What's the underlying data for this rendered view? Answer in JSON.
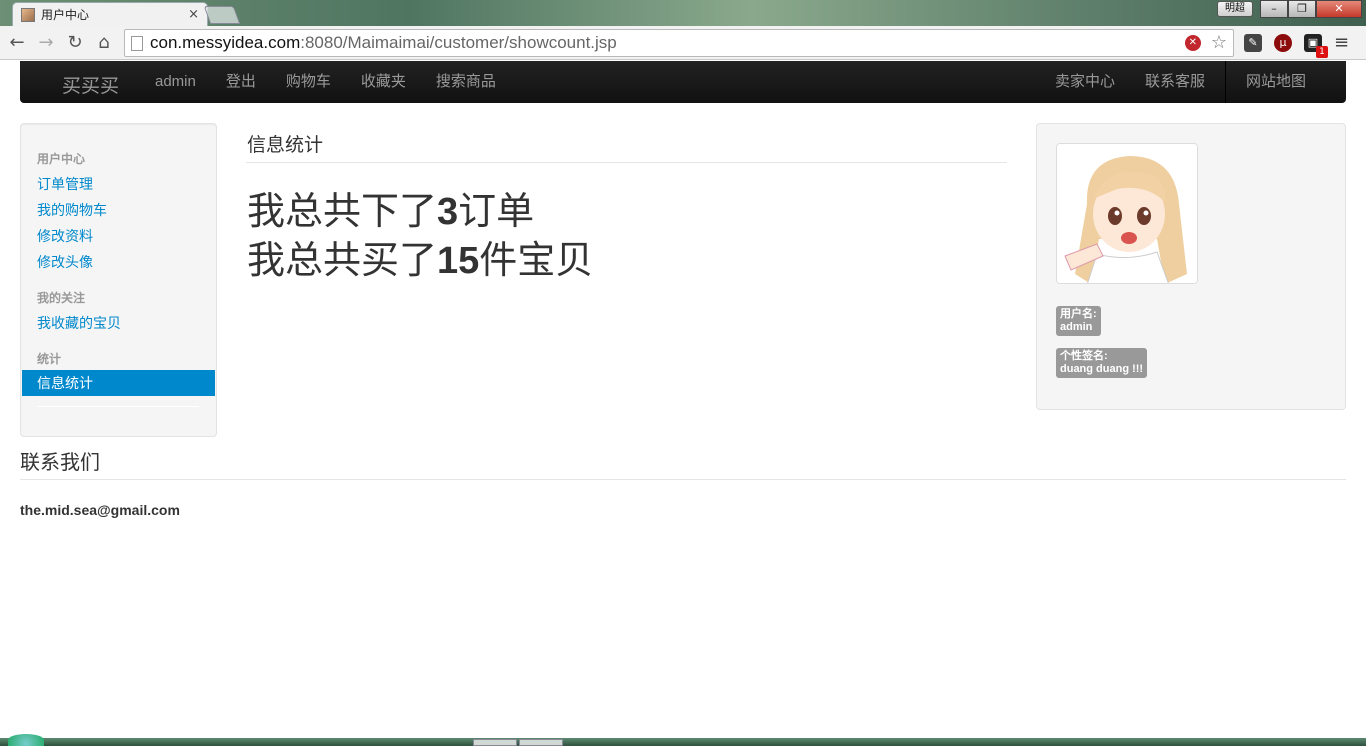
{
  "browser": {
    "tab_title": "用户中心",
    "tab_close": "×",
    "window_user": "明超",
    "window_buttons": [
      "–",
      "❐",
      "✕"
    ],
    "url_host": "con.messyidea.com",
    "url_rest": ":8080/Maimaimai/customer/showcount.jsp",
    "nav_glyphs": {
      "back": "←",
      "forward": "→",
      "reload": "↻",
      "home": "⌂"
    },
    "star": "☆",
    "menu": "≡",
    "ext_badge": "1"
  },
  "navbar": {
    "brand": "买买买",
    "left_items": [
      "admin",
      "登出",
      "购物车",
      "收藏夹",
      "搜索商品"
    ],
    "right_items": [
      "卖家中心",
      "联系客服",
      "网站地图"
    ]
  },
  "sidebar": {
    "sections": [
      {
        "header": "用户中心",
        "links": [
          "订单管理",
          "我的购物车",
          "修改资料",
          "修改头像"
        ]
      },
      {
        "header": "我的关注",
        "links": [
          "我收藏的宝贝"
        ]
      },
      {
        "header": "统计",
        "links": []
      }
    ],
    "active": "信息统计"
  },
  "main": {
    "title": "信息统计",
    "line1_prefix": "我总共下了",
    "line1_count": "3",
    "line1_suffix": "订单",
    "line2_prefix": "我总共买了",
    "line2_count": "15",
    "line2_suffix": "件宝贝"
  },
  "profile": {
    "username_label": "用户名:",
    "username": "admin",
    "signature_label": "个性签名:",
    "signature": "duang duang !!!"
  },
  "footer": {
    "title": "联系我们",
    "email": "the.mid.sea@gmail.com"
  },
  "colors": {
    "link": "#0088cc",
    "active_bg": "#0088cc",
    "navbar_bg": "#1b1b1b",
    "label_bg": "#999999"
  }
}
